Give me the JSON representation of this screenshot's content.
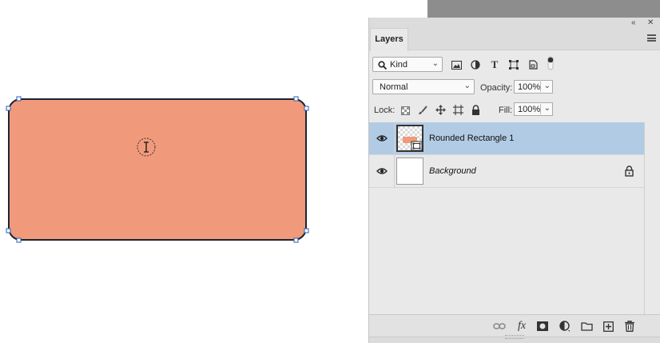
{
  "window": {
    "collapse_icon": "double-chevron-left-icon",
    "close_icon": "close-icon"
  },
  "panel": {
    "tab_label": "Layers",
    "menu_icon": "hamburger-menu-icon"
  },
  "filter": {
    "kind_label": "Kind",
    "kind_icon": "search-icon",
    "icons": [
      "image-filter-icon",
      "adjustment-filter-icon",
      "type-filter-icon",
      "shape-filter-icon",
      "smart-object-filter-icon",
      "filter-toggle-icon"
    ]
  },
  "blend": {
    "mode": "Normal",
    "opacity_label": "Opacity:",
    "opacity_value": "100%"
  },
  "lock": {
    "label": "Lock:",
    "icons": [
      "lock-transparent-pixels-icon",
      "lock-image-pixels-icon",
      "lock-position-icon",
      "lock-artboard-icon",
      "lock-all-icon"
    ],
    "fill_label": "Fill:",
    "fill_value": "100%"
  },
  "layers": [
    {
      "name": "Rounded Rectangle 1",
      "visible": true,
      "selected": true,
      "italic": false,
      "locked": false,
      "thumb_color": "#f19a7b"
    },
    {
      "name": "Background",
      "visible": true,
      "selected": false,
      "italic": true,
      "locked": true,
      "thumb_color": "#ffffff"
    }
  ],
  "bottom_bar": {
    "icons": [
      "link-layers-icon",
      "fx-icon",
      "add-mask-icon",
      "adjustment-layer-icon",
      "new-group-icon",
      "new-layer-icon",
      "delete-icon"
    ],
    "fx_label": "fx"
  },
  "canvas": {
    "shape_fill": "#f19a7b",
    "shape_stroke": "#1c2433",
    "cursor_icon": "text-cursor-icon"
  },
  "colors": {
    "selection": "#b2cbe5",
    "panel_bg": "#e9e9e9"
  }
}
